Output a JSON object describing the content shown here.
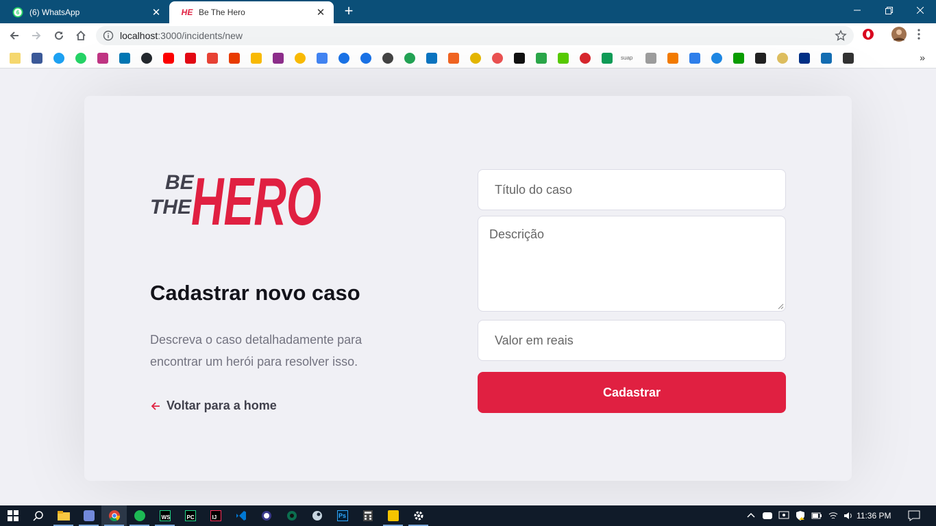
{
  "browser": {
    "tabs": [
      {
        "title": "(6) WhatsApp",
        "favicon": "whatsapp-icon",
        "badge": "6",
        "active": false
      },
      {
        "title": "Be The Hero",
        "favicon": "be-the-hero-icon",
        "favicon_text": "HE",
        "active": true
      }
    ],
    "url_host": "localhost",
    "url_path": ":3000/incidents/new",
    "accent": "#0b4f78"
  },
  "bookmarks": {
    "items": [
      "folder-icon",
      "facebook-icon",
      "twitter-icon",
      "whatsapp-icon",
      "instagram-icon",
      "linkedin-icon",
      "github-icon",
      "youtube-icon",
      "netflix-icon",
      "gmail-icon",
      "office-icon",
      "keep-icon",
      "app-icon",
      "photos-icon",
      "translate-icon",
      "contacts-icon",
      "messages-icon",
      "app-icon",
      "app-icon",
      "yahoo-icon",
      "app-icon",
      "trophy-icon",
      "udemy-icon",
      "app-icon",
      "app-icon",
      "duolingo-icon",
      "mega-icon",
      "drive-icon",
      "suap-icon",
      "app-icon",
      "app-icon",
      "app-icon",
      "app-icon",
      "techcrunch-icon",
      "app-icon",
      "app-icon",
      "paypal-icon",
      "app-icon",
      "app-icon"
    ],
    "suap_label": "suap"
  },
  "page": {
    "logo_top": "BE",
    "logo_mid": "THE",
    "logo_main": "HERO",
    "title": "Cadastrar novo caso",
    "description": "Descreva o caso detalhadamente para encontrar um herói para resolver isso.",
    "back_label": "Voltar para a home",
    "form": {
      "title_placeholder": "Título do caso",
      "description_placeholder": "Descrição",
      "value_placeholder": "Valor em reais",
      "submit_label": "Cadastrar"
    },
    "brand_color": "#e02041"
  },
  "taskbar": {
    "apps": [
      "start-icon",
      "search-icon",
      "file-explorer-icon",
      "discord-icon",
      "chrome-icon",
      "spotify-icon",
      "webstorm-icon",
      "pycharm-icon",
      "intellij-icon",
      "vscode-icon",
      "app-icon",
      "app-icon",
      "steam-icon",
      "photoshop-icon",
      "calculator-icon",
      "app-icon",
      "settings-icon"
    ],
    "webstorm_label": "WS",
    "pycharm_label": "PC",
    "intellij_label": "IJ",
    "photoshop_label": "Ps",
    "time": "11:36 PM"
  }
}
